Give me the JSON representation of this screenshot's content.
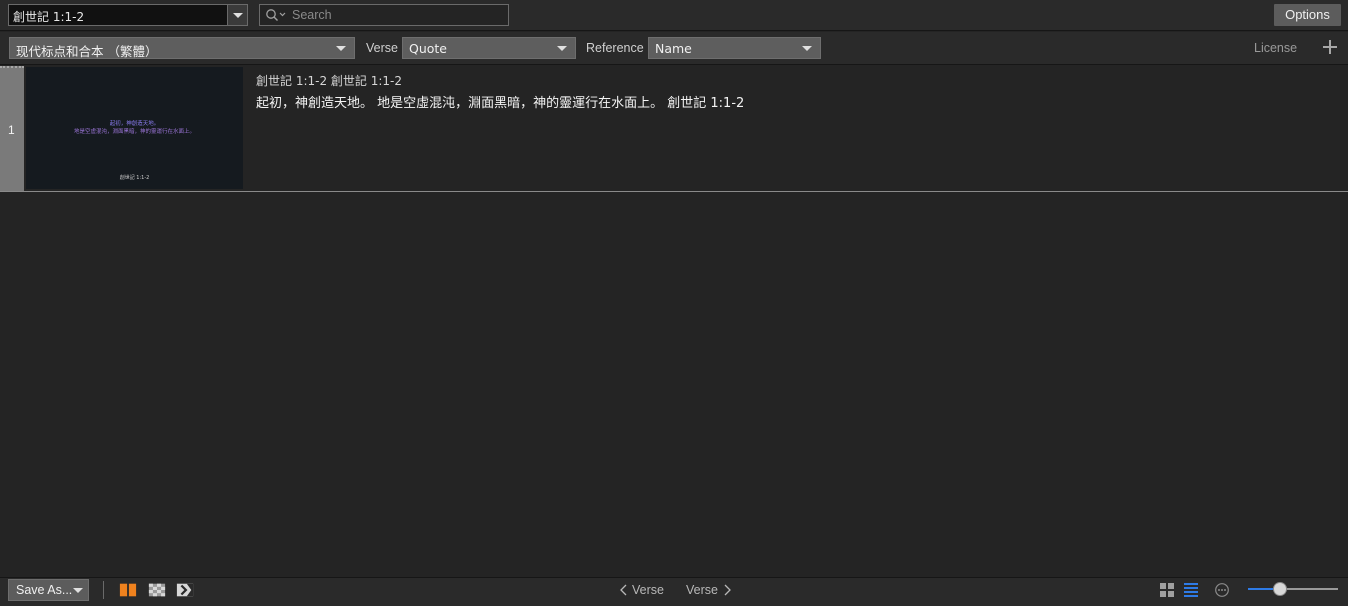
{
  "top": {
    "reference_value": "創世記 1:1-2",
    "search_placeholder": "Search",
    "options_label": "Options"
  },
  "toolbar": {
    "translation_value": "现代标点和合本 （繁體）",
    "verse_label": "Verse",
    "verse_value": "Quote",
    "reference_label": "Reference",
    "reference_value": "Name",
    "license_label": "License"
  },
  "rows": [
    {
      "number": "1",
      "header": "創世記 1:1-2  創世記 1:1-2",
      "text": "起初，神創造天地。 地是空虛混沌，淵面黑暗，神的靈運行在水面上。 創世記 1:1-2",
      "thumb_line1": "起初，神創造天地。",
      "thumb_line2": "地是空虛混沌，淵面黑暗，神的靈運行在水面上。",
      "thumb_ref": "創世記 1:1-2"
    }
  ],
  "bottom": {
    "save_as_label": "Save As...",
    "prev_label": "Verse",
    "next_label": "Verse",
    "zoom_level": 0.35,
    "colors": {
      "accent": "#f0821e",
      "selected_view": "#2e7be6"
    }
  }
}
